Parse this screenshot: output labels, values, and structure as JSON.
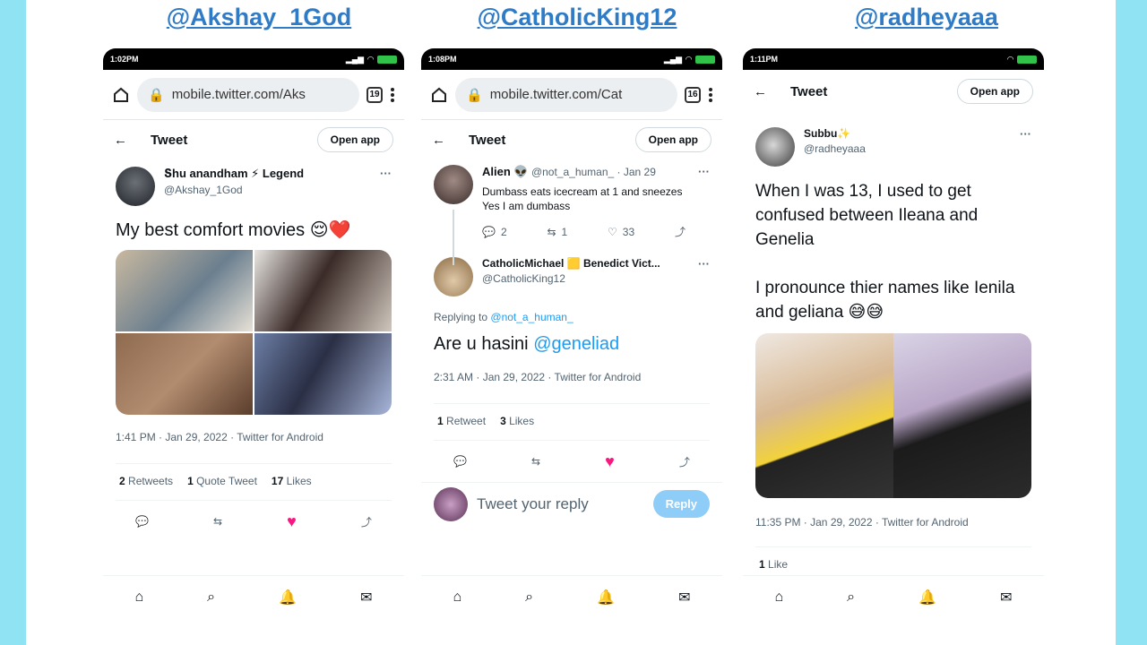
{
  "handles": [
    "@Akshay_1God",
    "@CatholicKing12",
    "@radheyaaa"
  ],
  "phone1": {
    "time": "1:02PM",
    "url": "mobile.twitter.com/Aks",
    "tabs": "19",
    "header_title": "Tweet",
    "open_app": "Open app",
    "author_name": "Տhu  anandham ⚡ Legend",
    "author_handle": "@Akshay_1God",
    "tweet_text": "My best comfort movies 😌❤️",
    "timestamp": "1:41 PM · Jan 29, 2022 · Twitter for Android",
    "retweets_count": "2",
    "retweets_label": "Retweets",
    "quote_count": "1",
    "quote_label": "Quote Tweet",
    "likes_count": "17",
    "likes_label": "Likes"
  },
  "phone2": {
    "time": "1:08PM",
    "url": "mobile.twitter.com/Cat",
    "tabs": "16",
    "header_title": "Tweet",
    "open_app": "Open app",
    "parent": {
      "name": "Alien 👽",
      "handle": "@not_a_human_ · Jan 29",
      "text_line1": "Dumbass eats icecream at 1 and sneezes",
      "text_line2": "Yes I am dumbass",
      "replies": "2",
      "retweets": "1",
      "likes": "33"
    },
    "author_name": "CatholicMichael 🟨 Benedict Vict...",
    "author_handle": "@CatholicKing12",
    "replying_prefix": "Replying to",
    "replying_to": "@not_a_human_",
    "tweet_text_prefix": "Are u hasini",
    "tweet_mention": "@geneliad",
    "timestamp": "2:31 AM · Jan 29, 2022 · Twitter for Android",
    "retweets_count": "1",
    "retweets_label": "Retweet",
    "likes_count": "3",
    "likes_label": "Likes",
    "reply_placeholder": "Tweet your reply",
    "reply_button": "Reply"
  },
  "phone3": {
    "time": "1:11PM",
    "header_title": "Tweet",
    "open_app": "Open app",
    "author_name": "Subbu✨",
    "author_handle": "@radheyaaa",
    "text_p1": "When I was 13, I used to get confused between Ileana and Genelia",
    "text_p2": "I pronounce thier names like Ienila and geliana  😅😅",
    "timestamp": "11:35 PM · Jan 29, 2022 · Twitter for Android",
    "likes_count": "1",
    "likes_label": "Like"
  },
  "colors": {
    "background": "#8fe3f2",
    "handle": "#2f7bc6",
    "like": "#f91880",
    "link": "#1d9bf0"
  }
}
